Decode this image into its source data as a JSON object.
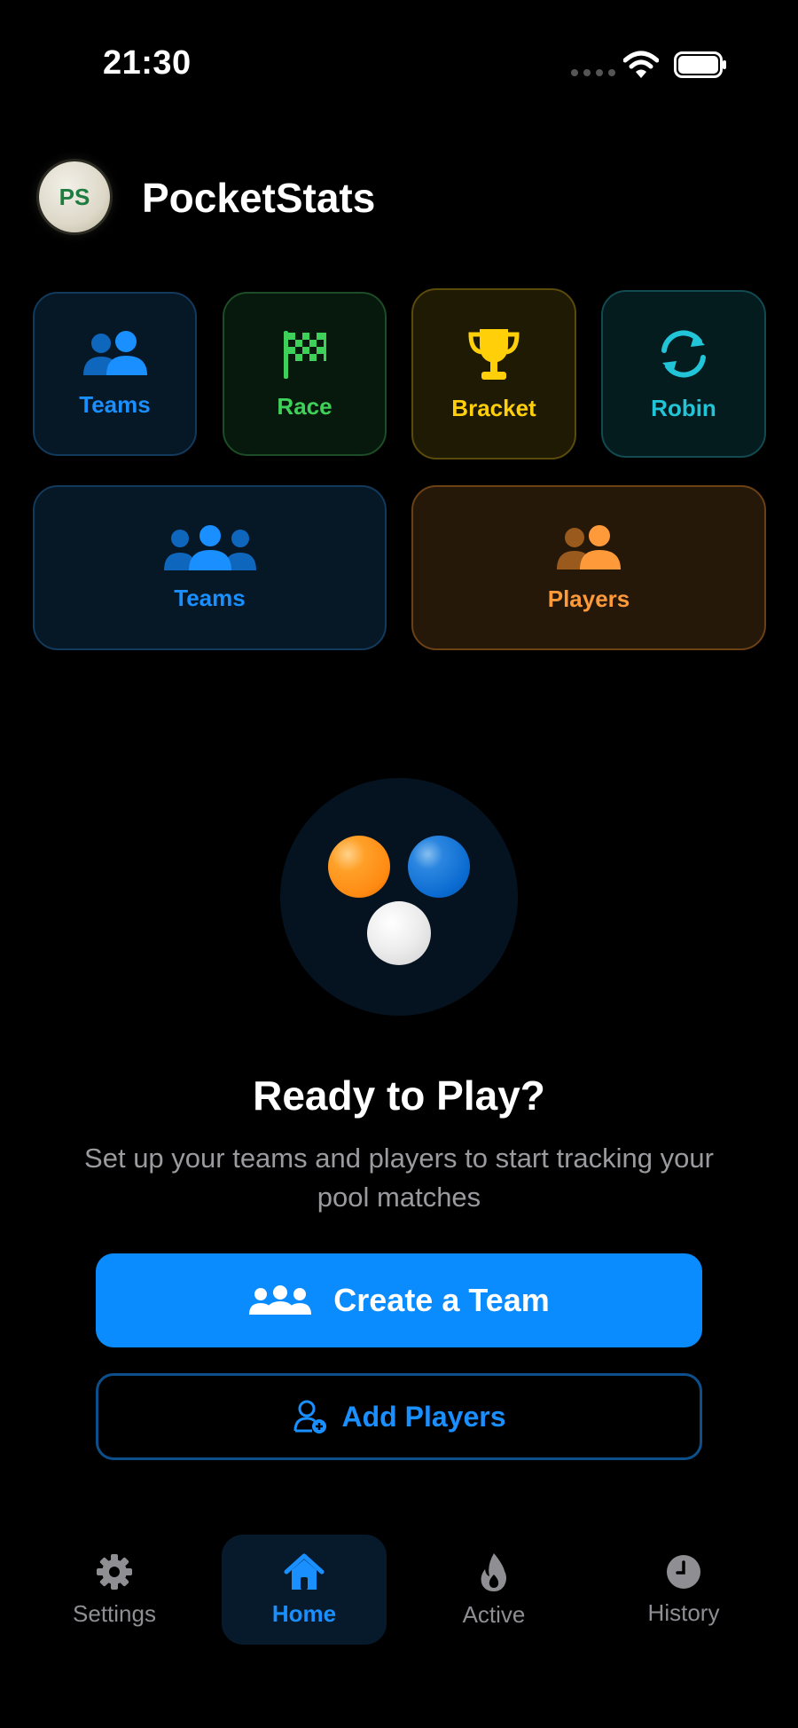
{
  "status_bar": {
    "time": "21:30"
  },
  "header": {
    "avatar_initials": "PS",
    "app_title": "PocketStats"
  },
  "tiles": {
    "row1": [
      {
        "label": "Teams",
        "icon": "two-people-icon",
        "color": "#1a8fff"
      },
      {
        "label": "Race",
        "icon": "checkered-flag-icon",
        "color": "#3fd05a"
      },
      {
        "label": "Bracket",
        "icon": "trophy-icon",
        "color": "#ffd00a"
      },
      {
        "label": "Robin",
        "icon": "rotate-arrows-icon",
        "color": "#22c4d8"
      }
    ],
    "row2": [
      {
        "label": "Teams",
        "icon": "group-icon",
        "color": "#1a8fff"
      },
      {
        "label": "Players",
        "icon": "two-people-icon",
        "color": "#ff9a3a"
      }
    ]
  },
  "hero": {
    "title": "Ready to Play?",
    "subtitle": "Set up your teams and players to start tracking your pool matches"
  },
  "actions": {
    "create_team_label": "Create a Team",
    "add_players_label": "Add Players"
  },
  "tab_bar": {
    "items": [
      {
        "label": "Settings",
        "icon": "gear-icon",
        "active": false
      },
      {
        "label": "Home",
        "icon": "house-icon",
        "active": true
      },
      {
        "label": "Active",
        "icon": "flame-icon",
        "active": false
      },
      {
        "label": "History",
        "icon": "clock-icon",
        "active": false
      }
    ]
  },
  "colors": {
    "accent": "#0a8cff",
    "background": "#000000"
  }
}
